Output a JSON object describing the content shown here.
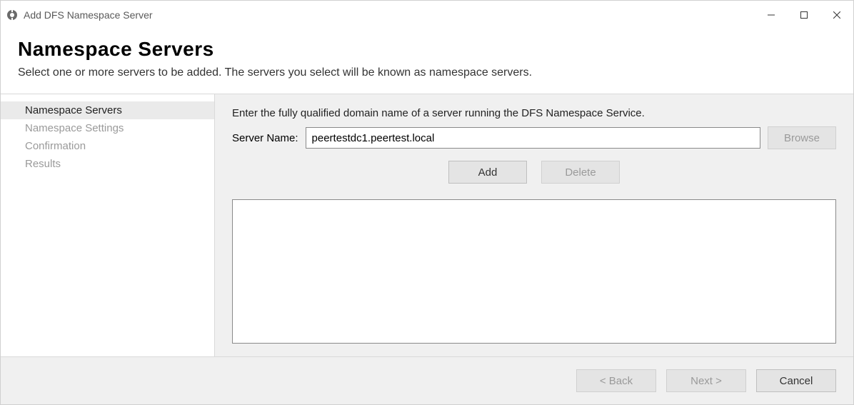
{
  "window": {
    "title": "Add DFS Namespace Server"
  },
  "header": {
    "heading": "Namespace Servers",
    "description": "Select one or more servers to be added. The servers you select will be known as namespace servers."
  },
  "sidebar": {
    "steps": [
      {
        "label": "Namespace Servers",
        "active": true
      },
      {
        "label": "Namespace Settings",
        "active": false
      },
      {
        "label": "Confirmation",
        "active": false
      },
      {
        "label": "Results",
        "active": false
      }
    ]
  },
  "main": {
    "instruction": "Enter the fully qualified domain name of a server running the DFS Namespace Service.",
    "server_label": "Server Name:",
    "server_value": "peertestdc1.peertest.local",
    "browse_label": "Browse",
    "add_label": "Add",
    "delete_label": "Delete"
  },
  "footer": {
    "back_label": "< Back",
    "next_label": "Next >",
    "cancel_label": "Cancel"
  }
}
